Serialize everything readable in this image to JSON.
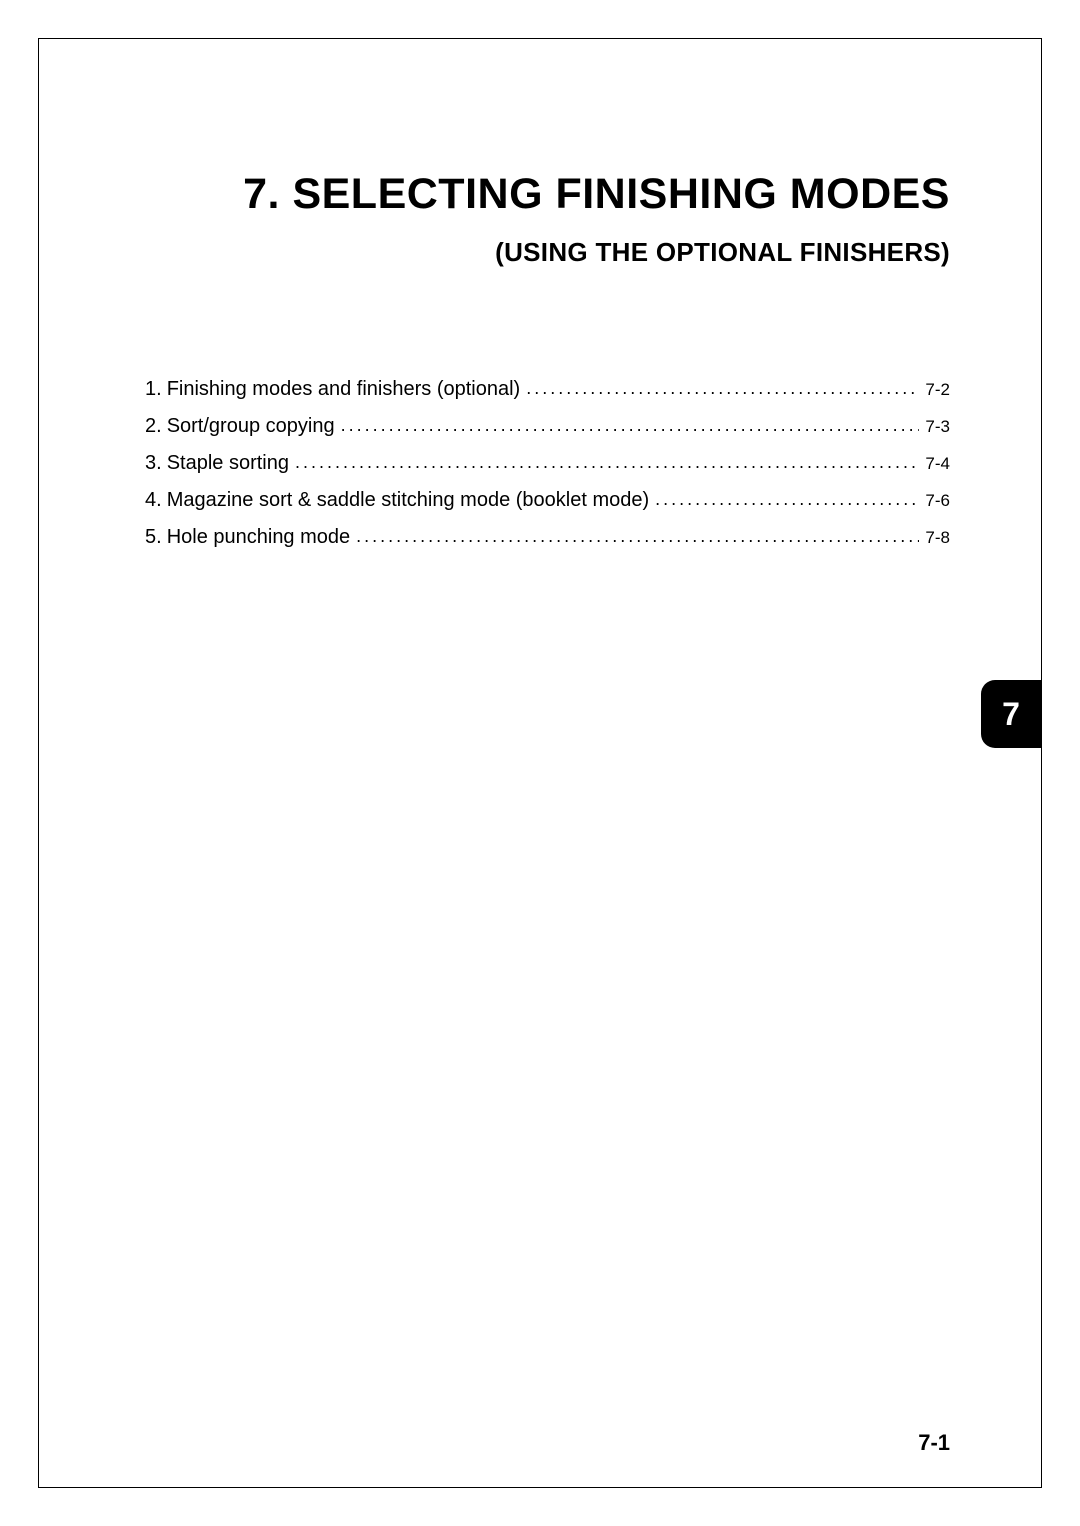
{
  "chapter": {
    "title": "7. SELECTING FINISHING MODES",
    "subtitle": "(USING THE OPTIONAL FINISHERS)"
  },
  "toc": [
    {
      "num": "1.",
      "text": "Finishing modes and finishers (optional)",
      "page": "7-2"
    },
    {
      "num": "2.",
      "text": "Sort/group copying",
      "page": "7-3"
    },
    {
      "num": "3.",
      "text": "Staple sorting",
      "page": "7-4"
    },
    {
      "num": "4.",
      "text": "Magazine sort & saddle stitching mode (booklet mode)",
      "page": "7-6"
    },
    {
      "num": "5.",
      "text": "Hole punching mode",
      "page": "7-8"
    }
  ],
  "thumbTab": "7",
  "pageNumber": "7-1"
}
